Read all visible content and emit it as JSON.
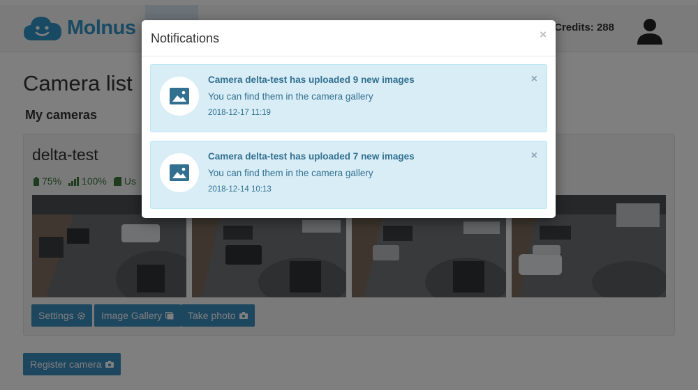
{
  "header": {
    "logo_text": "Molnus",
    "credits_label": "Credits: 288"
  },
  "page": {
    "title": "Camera list",
    "section_title": "My cameras"
  },
  "camera": {
    "name": "delta-test",
    "battery": "75%",
    "signal": "100%",
    "storage_partial": "Us",
    "buttons": {
      "settings": "Settings",
      "gallery": "Image Gallery",
      "take_photo": "Take photo"
    }
  },
  "register_button": "Register camera",
  "modal": {
    "title": "Notifications",
    "close": "×",
    "notifications": [
      {
        "title": "Camera delta-test has uploaded 9 new images",
        "body": "You can find them in the camera gallery",
        "time": "2018-12-17 11:19",
        "close": "×"
      },
      {
        "title": "Camera delta-test has uploaded 7 new images",
        "body": "You can find them in the camera gallery",
        "time": "2018-12-14 10:13",
        "close": "×"
      }
    ]
  },
  "colors": {
    "brand": "#3394c8",
    "button": "#3a8dbe",
    "info_bg": "#d9edf7",
    "info_text": "#31708f",
    "success": "#3c763d"
  },
  "icons": {
    "logo": "cloud-face-icon",
    "user": "user-icon",
    "notification": "image-icon",
    "settings": "gear-icon",
    "gallery": "gallery-icon",
    "camera": "camera-icon",
    "battery": "battery-icon",
    "signal": "signal-icon",
    "storage": "sd-card-icon"
  }
}
